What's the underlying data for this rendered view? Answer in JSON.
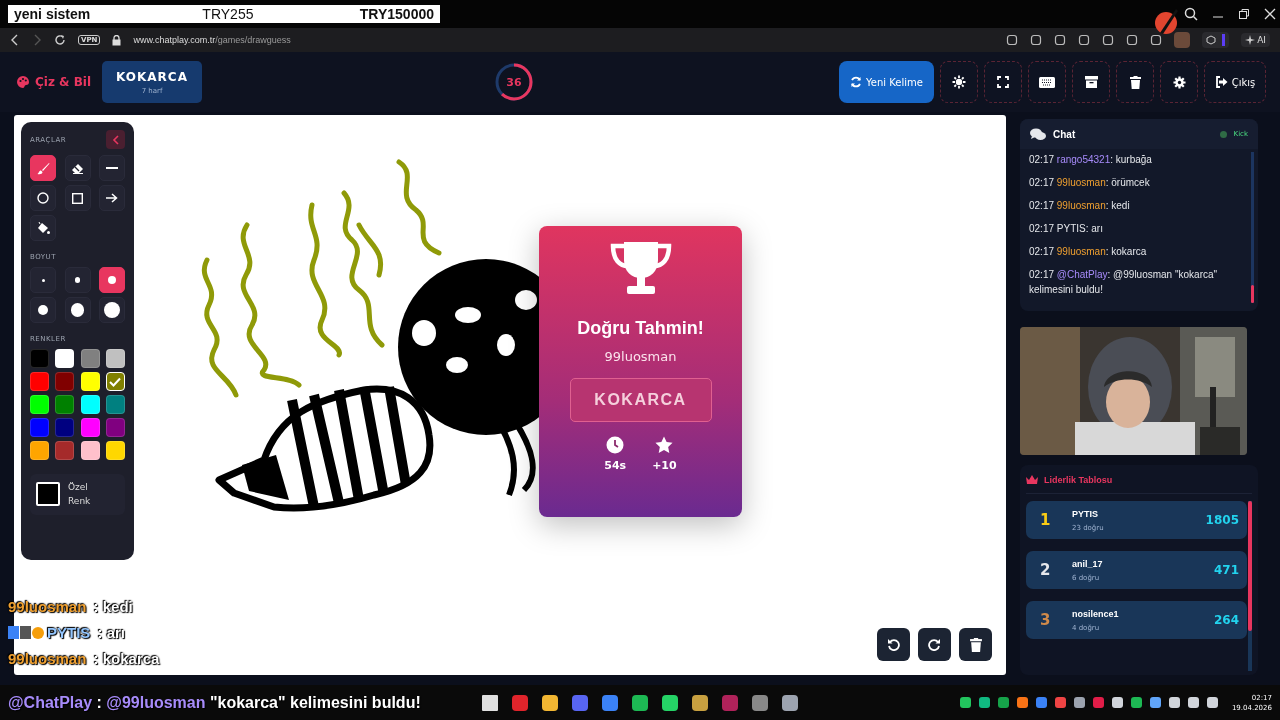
{
  "stream_header": {
    "title": "yeni sistem",
    "amount": "TRY255",
    "goal": "TRY150000"
  },
  "browser": {
    "host": "www.chatplay.com.tr",
    "path": "/games/drawguess",
    "vpn": "VPN",
    "ai": "AI"
  },
  "header": {
    "logo": "Çiz & Bil",
    "word": "KOKARCA",
    "word_hint": "7 harf",
    "timer": "36",
    "level": 0.62,
    "buttons": [
      {
        "kind": "refresh",
        "label": "Yeni Kelime"
      },
      {
        "kind": "sun"
      },
      {
        "kind": "fullscreen"
      },
      {
        "kind": "keyboard"
      },
      {
        "kind": "archive"
      },
      {
        "kind": "trash"
      },
      {
        "kind": "gear"
      },
      {
        "kind": "exit",
        "label": "Çıkış"
      }
    ]
  },
  "tools": {
    "title": "ARAÇLAR",
    "items": [
      {
        "kind": "brush",
        "selected": true
      },
      {
        "kind": "eraser",
        "selected": false
      },
      {
        "kind": "line",
        "selected": false
      },
      {
        "kind": "circle",
        "selected": false
      },
      {
        "kind": "rect",
        "selected": false
      },
      {
        "kind": "arrow",
        "selected": false
      },
      {
        "kind": "fill",
        "selected": false
      }
    ],
    "size_title": "BOYUT",
    "sizes": [
      {
        "selected": false
      },
      {
        "selected": false
      },
      {
        "selected": true
      },
      {
        "selected": false
      },
      {
        "selected": false
      },
      {
        "selected": false
      }
    ],
    "colors_title": "RENKLER",
    "colors": [
      {
        "color": "#000000",
        "selected": false
      },
      {
        "color": "#ffffff",
        "selected": false
      },
      {
        "color": "#808080",
        "selected": false
      },
      {
        "color": "#c0c0c0",
        "selected": false
      },
      {
        "color": "#ff0000",
        "selected": false
      },
      {
        "color": "#800000",
        "selected": false
      },
      {
        "color": "#ffff00",
        "selected": false
      },
      {
        "color": "#808000",
        "selected": true
      },
      {
        "color": "#00ff00",
        "selected": false
      },
      {
        "color": "#008000",
        "selected": false
      },
      {
        "color": "#00ffff",
        "selected": false
      },
      {
        "color": "#008080",
        "selected": false
      },
      {
        "color": "#0000ff",
        "selected": false
      },
      {
        "color": "#000080",
        "selected": false
      },
      {
        "color": "#ff00ff",
        "selected": false
      },
      {
        "color": "#800080",
        "selected": false
      },
      {
        "color": "#ffa500",
        "selected": false
      },
      {
        "color": "#a52a2a",
        "selected": false
      },
      {
        "color": "#ffc0cb",
        "selected": false
      },
      {
        "color": "#ffd700",
        "selected": false
      }
    ],
    "custom_label": "Özel Renk"
  },
  "result": {
    "title": "Doğru Tahmin!",
    "player": "99luosman",
    "word": "KOKARCA",
    "time": "54s",
    "points": "+10"
  },
  "canvas_controls": [
    {
      "kind": "undo"
    },
    {
      "kind": "redo"
    },
    {
      "kind": "clear"
    }
  ],
  "chat": {
    "title": "Chat",
    "source": "Kick",
    "messages": [
      {
        "time": "02:17",
        "user": "rango54321",
        "color": "#a78bfa",
        "text": ": kurbağa"
      },
      {
        "time": "02:17",
        "user": "99luosman",
        "color": "#f0a030",
        "text": ": örümcek"
      },
      {
        "time": "02:17",
        "user": "99luosman",
        "color": "#f0a030",
        "text": ": kedi"
      },
      {
        "time": "02:17",
        "user": "PYTIS",
        "color": "#e5e7eb",
        "text": ": arı"
      },
      {
        "time": "02:17",
        "user": "99luosman",
        "color": "#f0a030",
        "text": ": kokarca"
      },
      {
        "time": "02:17",
        "user": "@ChatPlay",
        "color": "#a78bfa",
        "text": ": @99luosman \"kokarca\" kelimesini buldu!"
      }
    ]
  },
  "leaderboard": {
    "title": "Liderlik Tablosu",
    "rows": [
      {
        "rank": "1",
        "name": "PYTIS",
        "sub": "23 doğru",
        "score": "1805",
        "color": "#facc15"
      },
      {
        "rank": "2",
        "name": "anil_17",
        "sub": "6 doğru",
        "score": "471",
        "color": "#e5e7eb"
      },
      {
        "rank": "3",
        "name": "nosilence1",
        "sub": "4 doğru",
        "score": "264",
        "color": "#d08a4a"
      }
    ]
  },
  "stream_chat": [
    {
      "user": "99luosman",
      "color": "#f0a030",
      "text": " : kedi",
      "badges": false
    },
    {
      "user": "PYTIS",
      "color": "#93c5fd",
      "text": " : arı",
      "badges": true
    },
    {
      "user": "99luosman",
      "color": "#f0a030",
      "text": " : kokarca",
      "badges": false
    }
  ],
  "ticker": [
    {
      "text": "@ChatPlay",
      "color": "#a78bfa"
    },
    {
      "text": " : ",
      "color": "#ffffff"
    },
    {
      "text": "@99luosman",
      "color": "#a78bfa"
    },
    {
      "text": " \"kokarca\" kelimesini buldu!",
      "color": "#ffffff"
    }
  ],
  "clock": {
    "time": "02:17",
    "date": "19.04.2026"
  }
}
